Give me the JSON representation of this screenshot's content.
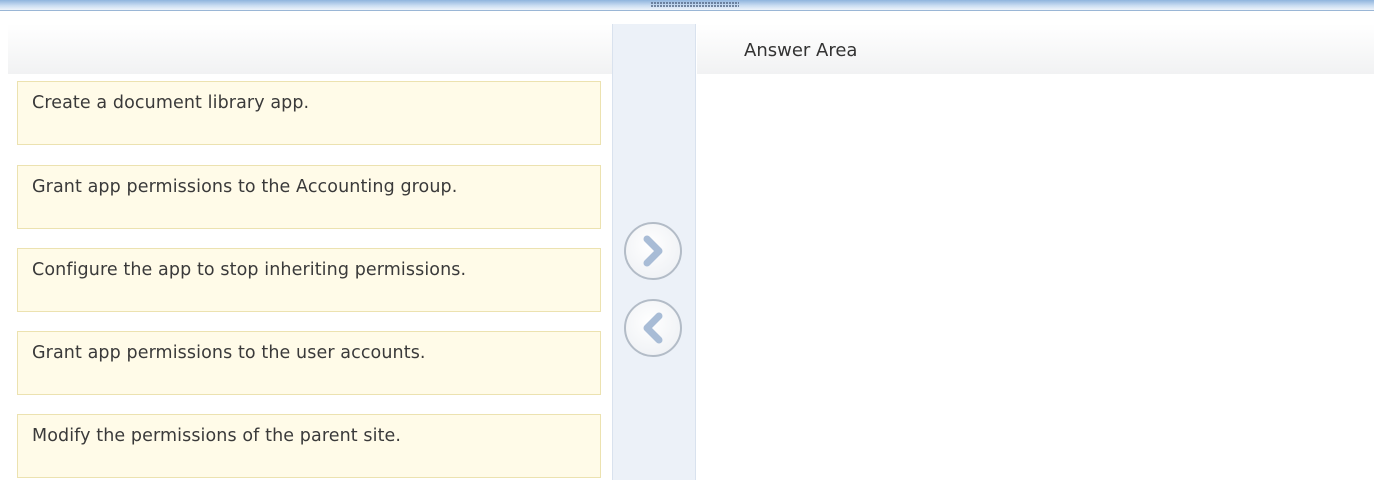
{
  "answer_area": {
    "title": "Answer Area"
  },
  "choices": [
    {
      "label": "Create a document library app."
    },
    {
      "label": "Grant app permissions to the Accounting group."
    },
    {
      "label": "Configure the app to stop inheriting permissions."
    },
    {
      "label": "Grant app permissions to the user accounts."
    },
    {
      "label": "Modify the permissions of the parent site."
    }
  ],
  "controls": {
    "move_right_icon": "chevron-right-icon",
    "move_left_icon": "chevron-left-icon"
  },
  "colors": {
    "choice_background": "#fffbe8",
    "choice_border": "#ece2b0",
    "divider_background": "#ecf1f8",
    "top_bar": "#8fb4dd",
    "arrow_accent": "#9fb6d3"
  }
}
